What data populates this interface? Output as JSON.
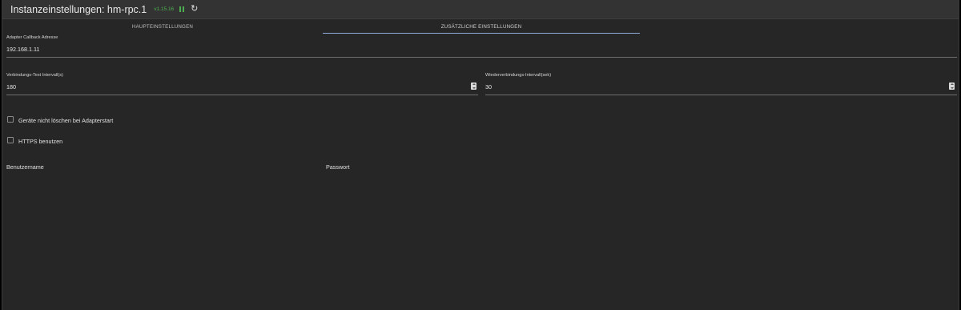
{
  "header": {
    "title": "Instanzeinstellungen: hm-rpc.1",
    "version": "v1.15.16",
    "pause_icon": "pause-icon",
    "reload_icon": "reload-icon"
  },
  "tabs": [
    {
      "label": "HAUPTEINSTELLUNGEN",
      "active": false
    },
    {
      "label": "ZUSÄTZLICHE EINSTELLUNGEN",
      "active": true
    }
  ],
  "fields": {
    "callback": {
      "label": "Adapter Callback Adresse",
      "value": "192.168.1.11"
    },
    "test_interval": {
      "label": "Verbindungs-Test Intervall(s)",
      "value": "180"
    },
    "reconnect_interval": {
      "label": "Wiederverbindungs-Intervall(sek)",
      "value": "30"
    }
  },
  "checkboxes": {
    "dont_delete": {
      "label": "Geräte nicht löschen bei Adapterstart",
      "checked": false
    },
    "https": {
      "label": "HTTPS benutzen",
      "checked": false
    }
  },
  "credentials": {
    "username_label": "Benutzername",
    "password_label": "Passwort"
  },
  "colors": {
    "background": "#262626",
    "header": "#333333",
    "accent_green": "#4caf50",
    "tab_indicator": "#90a9d8"
  }
}
